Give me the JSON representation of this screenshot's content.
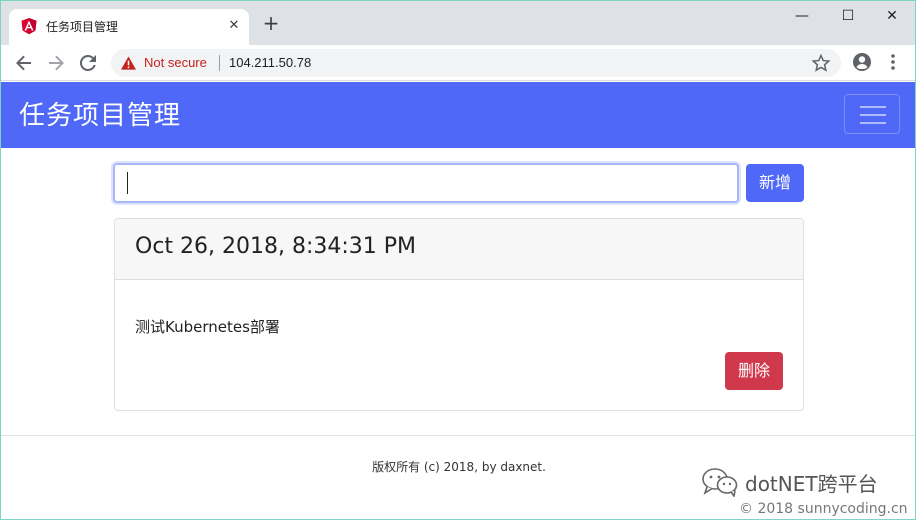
{
  "browser": {
    "tab_title": "任务项目管理",
    "tab_close": "✕",
    "new_tab": "+",
    "security_label": "Not secure",
    "url": "104.211.50.78",
    "window_minimize": "—",
    "window_maximize": "☐",
    "window_close": "✕"
  },
  "navbar": {
    "brand": "任务项目管理"
  },
  "form": {
    "input_value": "",
    "add_label": "新增"
  },
  "tasks": [
    {
      "time": "Oct 26, 2018, 8:34:31 PM",
      "text": "测试Kubernetes部署",
      "delete_label": "删除"
    }
  ],
  "footer": {
    "text": "版权所有 (c) 2018, by daxnet."
  },
  "watermark": {
    "name": "dotNET跨平台",
    "copyright": "© 2018 sunnycoding.cn"
  },
  "colors": {
    "accent": "#4f68f8",
    "danger": "#d0384b",
    "warning": "#c5221f"
  }
}
